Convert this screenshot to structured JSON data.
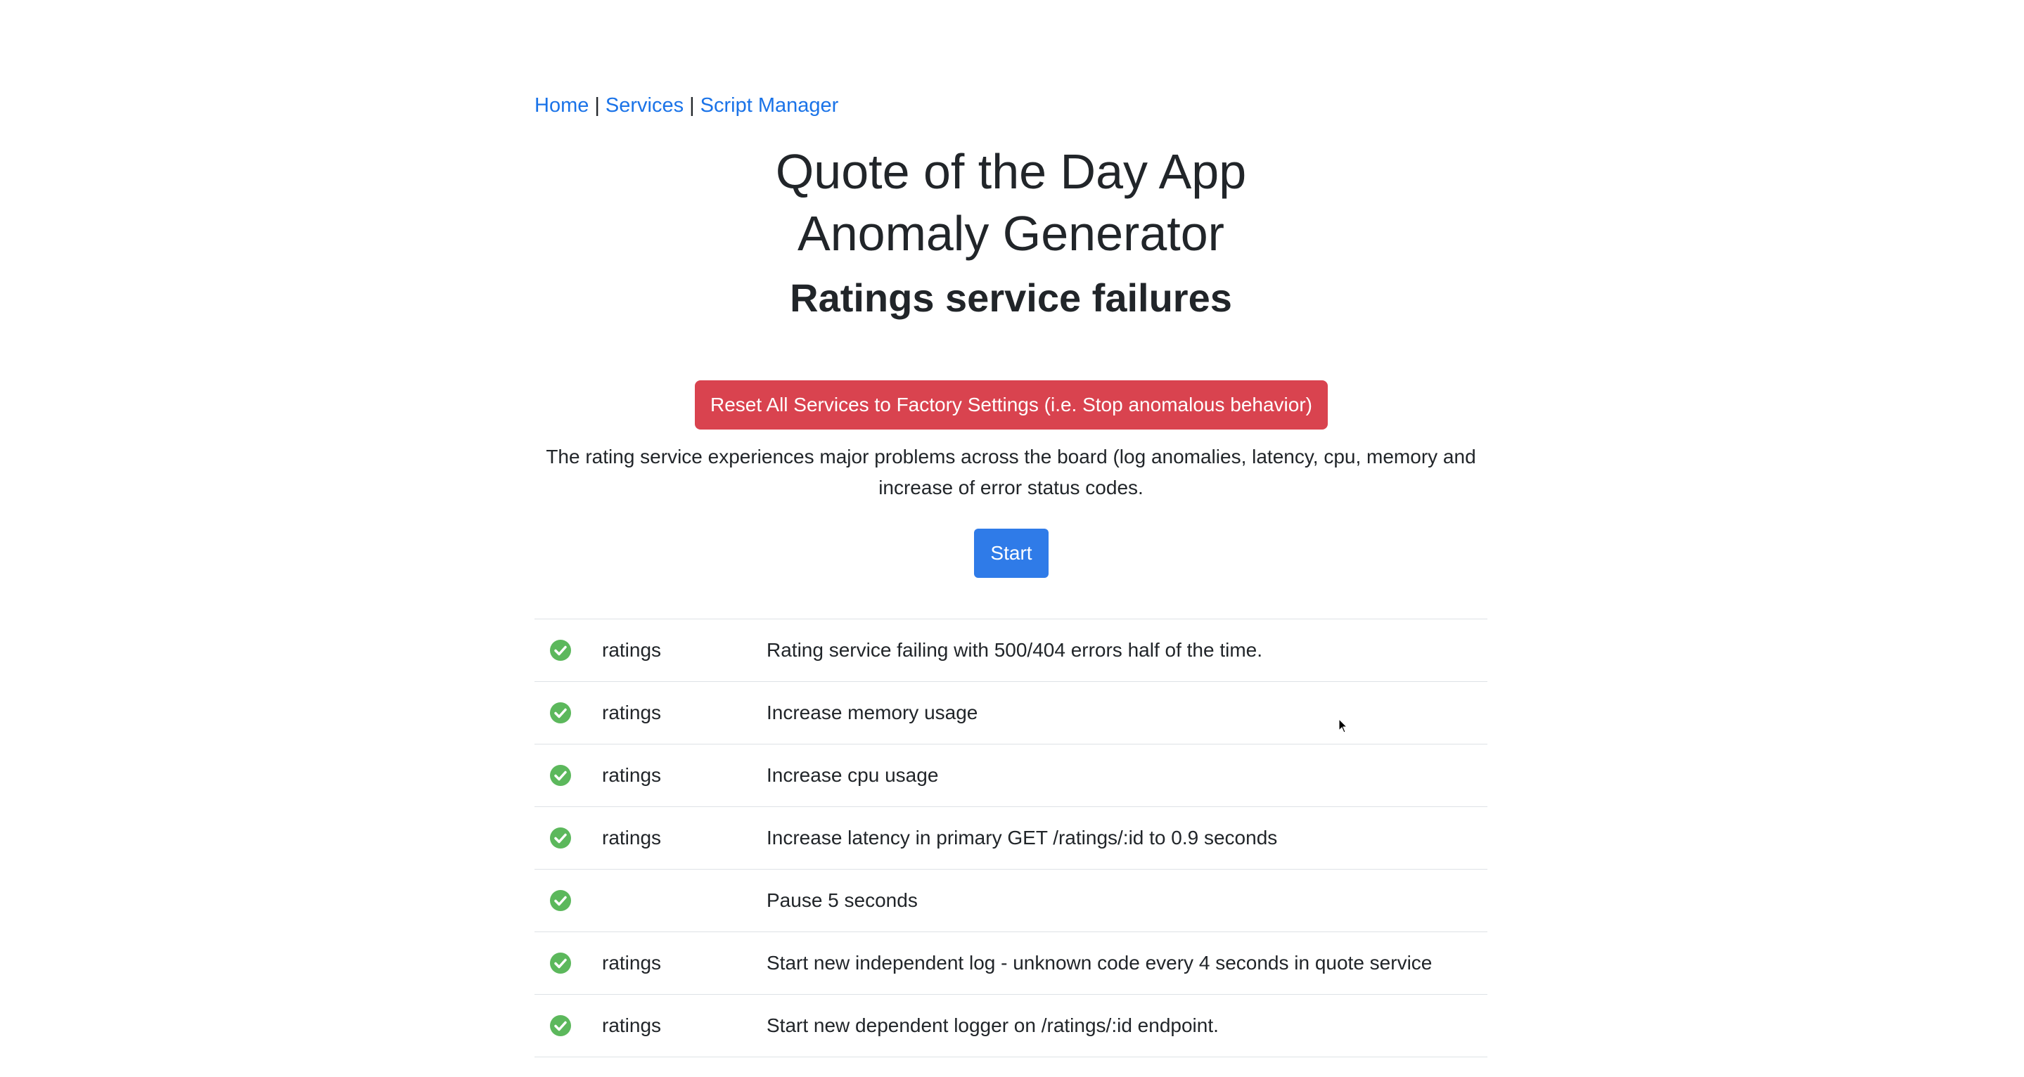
{
  "nav": {
    "home": "Home",
    "services": "Services",
    "script_manager": "Script Manager",
    "separator": "|"
  },
  "header": {
    "title_line1": "Quote of the Day App",
    "title_line2": "Anomaly Generator",
    "subtitle": "Ratings service failures"
  },
  "actions": {
    "reset_label": "Reset All Services to Factory Settings (i.e. Stop anomalous behavior)",
    "reset_color": "#d9434f",
    "start_label": "Start",
    "start_color": "#2f7be8"
  },
  "description": "The rating service experiences major problems across the board (log anomalies, latency, cpu, memory and increase of error status codes.",
  "steps": [
    {
      "status": "check-circle-icon",
      "service": "ratings",
      "description": "Rating service failing with 500/404 errors half of the time."
    },
    {
      "status": "check-circle-icon",
      "service": "ratings",
      "description": "Increase memory usage"
    },
    {
      "status": "check-circle-icon",
      "service": "ratings",
      "description": "Increase cpu usage"
    },
    {
      "status": "check-circle-icon",
      "service": "ratings",
      "description": "Increase latency in primary GET /ratings/:id to 0.9 seconds"
    },
    {
      "status": "check-circle-icon",
      "service": "",
      "description": "Pause 5 seconds"
    },
    {
      "status": "check-circle-icon",
      "service": "ratings",
      "description": "Start new independent log - unknown code every 4 seconds in quote service"
    },
    {
      "status": "check-circle-icon",
      "service": "ratings",
      "description": "Start new dependent logger on /ratings/:id endpoint."
    }
  ],
  "colors": {
    "link": "#1a73e8",
    "success": "#5cb85c"
  }
}
